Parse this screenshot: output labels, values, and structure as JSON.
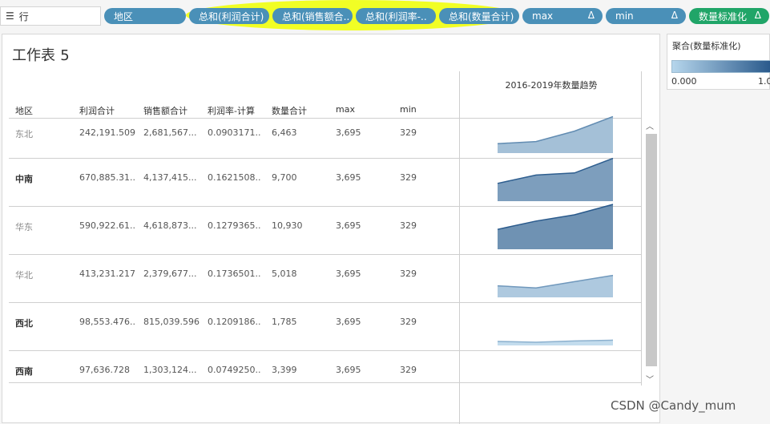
{
  "shelf": {
    "label": "行",
    "icon": "list-icon",
    "pills": [
      {
        "label": "地区",
        "color": "#4a90b8"
      },
      {
        "label": "总和(利润合计)",
        "color": "#4a90b8"
      },
      {
        "label": "总和(销售额合..",
        "color": "#4a90b8"
      },
      {
        "label": "总和(利润率-..",
        "color": "#4a90b8"
      },
      {
        "label": "总和(数量合计)",
        "color": "#4a90b8"
      },
      {
        "label": "max",
        "delta": "Δ",
        "color": "#4a90b8"
      },
      {
        "label": "min",
        "delta": "Δ",
        "color": "#4a90b8"
      },
      {
        "label": "数量标准化",
        "delta": "Δ",
        "color": "#20a568"
      }
    ]
  },
  "sheet": {
    "title_main": "工作表",
    "title_num": "5",
    "trend_title": "2016-2019年数量趋势",
    "columns": [
      "地区",
      "利润合计",
      "销售额合计",
      "利润率-计算",
      "数量合计",
      "max",
      "min"
    ],
    "rows": [
      {
        "region": "东北",
        "profit": "242,191.509",
        "sales": "2,681,567...",
        "rate": "0.0903171..",
        "qty": "6,463",
        "max": "3,695",
        "min": "329",
        "trend": [
          0.15,
          0.2,
          0.45,
          0.8
        ],
        "norm": 0.35
      },
      {
        "region": "中南",
        "profit": "670,885.31..",
        "sales": "4,137,415...",
        "rate": "0.1621508..",
        "qty": "9,700",
        "max": "3,695",
        "min": "329",
        "trend": [
          0.35,
          0.55,
          0.6,
          0.95
        ],
        "norm": 0.72
      },
      {
        "region": "华东",
        "profit": "590,922.61..",
        "sales": "4,618,873...",
        "rate": "0.1279365..",
        "qty": "10,930",
        "max": "3,695",
        "min": "329",
        "trend": [
          0.4,
          0.6,
          0.75,
          1.0
        ],
        "norm": 0.85
      },
      {
        "region": "华北",
        "profit": "413,231.217",
        "sales": "2,379,677...",
        "rate": "0.1736501..",
        "qty": "5,018",
        "max": "3,695",
        "min": "329",
        "trend": [
          0.2,
          0.15,
          0.3,
          0.45
        ],
        "norm": 0.25
      },
      {
        "region": "西北",
        "profit": "98,553.476..",
        "sales": "815,039.596",
        "rate": "0.1209186..",
        "qty": "1,785",
        "max": "3,695",
        "min": "329",
        "trend": [
          0.02,
          0.0,
          0.03,
          0.05
        ],
        "norm": 0.05
      },
      {
        "region": "西南",
        "profit": "97,636.728",
        "sales": "1,303,124...",
        "rate": "0.0749250..",
        "qty": "3,399",
        "max": "3,695",
        "min": "329",
        "trend": [],
        "norm": 0.1
      }
    ]
  },
  "legend": {
    "title": "聚合(数量标准化)",
    "min": "0.000",
    "max": "1.0"
  },
  "watermark": "CSDN @Candy_mum"
}
